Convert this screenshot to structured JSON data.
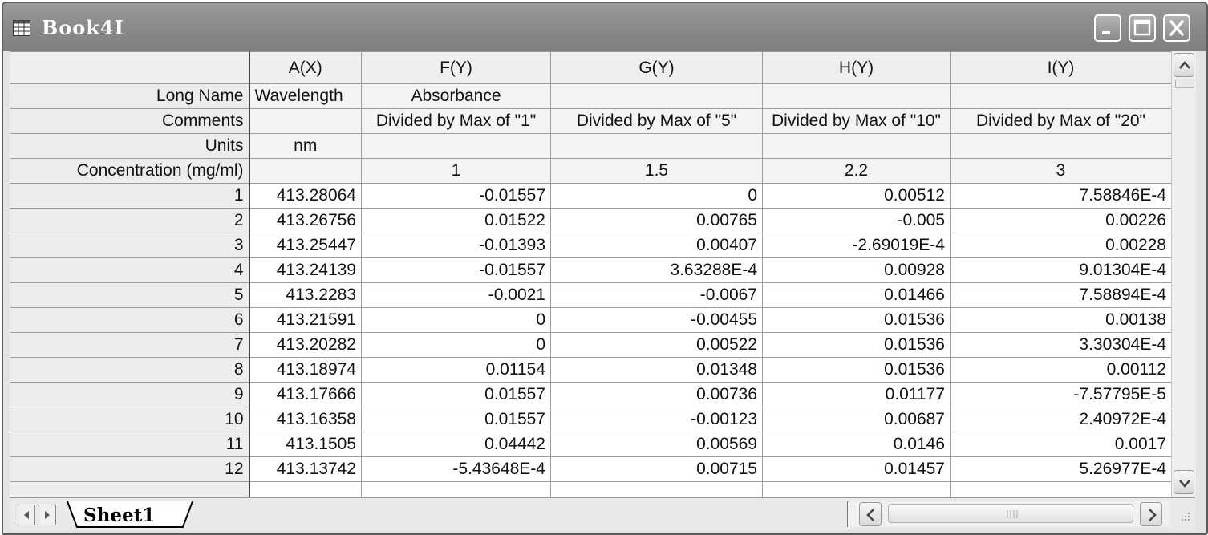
{
  "window": {
    "title": "Book4I",
    "icon": "worksheet-grid-icon",
    "controls": [
      "minimize-icon",
      "maximize-icon",
      "close-icon"
    ]
  },
  "columns": [
    "",
    "A(X)",
    "F(Y)",
    "G(Y)",
    "H(Y)",
    "I(Y)"
  ],
  "label_rows": [
    {
      "label": "Long Name",
      "cells": [
        "Wavelength",
        "Absorbance",
        "",
        "",
        ""
      ]
    },
    {
      "label": "Comments",
      "cells": [
        "",
        "Divided by Max of \"1\"",
        "Divided by Max of \"5\"",
        "Divided by Max of \"10\"",
        "Divided by Max of \"20\""
      ]
    },
    {
      "label": "Units",
      "cells": [
        "nm",
        "",
        "",
        "",
        ""
      ]
    },
    {
      "label": "Concentration (mg/ml)",
      "cells": [
        "",
        "1",
        "1.5",
        "2.2",
        "3"
      ]
    }
  ],
  "data_rows": [
    {
      "index": "1",
      "cells": [
        "413.28064",
        "-0.01557",
        "0",
        "0.00512",
        "7.58846E-4"
      ]
    },
    {
      "index": "2",
      "cells": [
        "413.26756",
        "0.01522",
        "0.00765",
        "-0.005",
        "0.00226"
      ]
    },
    {
      "index": "3",
      "cells": [
        "413.25447",
        "-0.01393",
        "0.00407",
        "-2.69019E-4",
        "0.00228"
      ]
    },
    {
      "index": "4",
      "cells": [
        "413.24139",
        "-0.01557",
        "3.63288E-4",
        "0.00928",
        "9.01304E-4"
      ]
    },
    {
      "index": "5",
      "cells": [
        "413.2283",
        "-0.0021",
        "-0.0067",
        "0.01466",
        "7.58894E-4"
      ]
    },
    {
      "index": "6",
      "cells": [
        "413.21591",
        "0",
        "-0.00455",
        "0.01536",
        "0.00138"
      ]
    },
    {
      "index": "7",
      "cells": [
        "413.20282",
        "0",
        "0.00522",
        "0.01536",
        "3.30304E-4"
      ]
    },
    {
      "index": "8",
      "cells": [
        "413.18974",
        "0.01154",
        "0.01348",
        "0.01536",
        "0.00112"
      ]
    },
    {
      "index": "9",
      "cells": [
        "413.17666",
        "0.01557",
        "0.00736",
        "0.01177",
        "-7.57795E-5"
      ]
    },
    {
      "index": "10",
      "cells": [
        "413.16358",
        "0.01557",
        "-0.00123",
        "0.00687",
        "2.40972E-4"
      ]
    },
    {
      "index": "11",
      "cells": [
        "413.1505",
        "0.04442",
        "0.00569",
        "0.0146",
        "0.0017"
      ]
    },
    {
      "index": "12",
      "cells": [
        "413.13742",
        "-5.43648E-4",
        "0.00715",
        "0.01457",
        "5.26977E-4"
      ]
    }
  ],
  "sheet_tabs": [
    {
      "label": "Sheet1",
      "active": true
    }
  ]
}
